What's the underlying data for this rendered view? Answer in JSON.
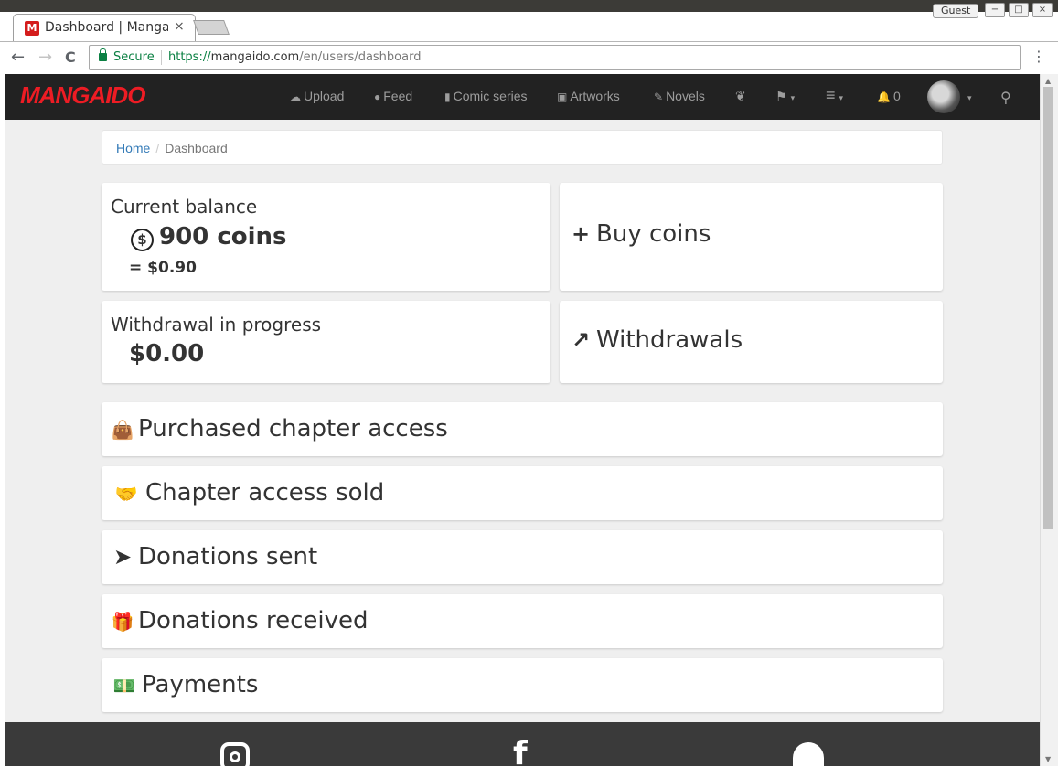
{
  "browser": {
    "tab_title": "Dashboard | Manga",
    "tab_favicon": "M",
    "tab_close": "×",
    "guest_label": "Guest",
    "window_buttons": [
      "−",
      "□",
      "×"
    ],
    "back": "←",
    "forward": "→",
    "reload": "C",
    "secure_label": "Secure",
    "url_scheme": "https://",
    "url_host": "mangaido.com",
    "url_path": "/en/users/dashboard",
    "menu": "⋮"
  },
  "navbar": {
    "logo": "MANGAIDO",
    "items": [
      {
        "icon": "upload-cloud-icon",
        "glyph": "☁",
        "label": "Upload"
      },
      {
        "icon": "chat-icon",
        "glyph": "●",
        "label": "Feed"
      },
      {
        "icon": "book-icon",
        "glyph": "▮",
        "label": "Comic series"
      },
      {
        "icon": "picture-icon",
        "glyph": "▣",
        "label": "Artworks"
      },
      {
        "icon": "edit-icon",
        "glyph": "✎",
        "label": "Novels"
      }
    ],
    "bowl_glyph": "❦",
    "flag_glyph": "⚑",
    "menu_glyph": "≡",
    "caret": "▾",
    "bell_glyph": "🔔",
    "notification_count": "0",
    "search_glyph": "⚲"
  },
  "breadcrumb": {
    "home": "Home",
    "separator": "/",
    "current": "Dashboard"
  },
  "balance": {
    "label": "Current balance",
    "coin_symbol": "$",
    "coins": "900 coins",
    "usd": "= $0.90"
  },
  "buy": {
    "glyph": "+",
    "label": "Buy coins"
  },
  "withdrawal": {
    "label": "Withdrawal in progress",
    "amount": "$0.00"
  },
  "withdrawals": {
    "glyph": "↗",
    "label": "Withdrawals"
  },
  "sections": [
    {
      "icon": "shopping-bag-icon",
      "glyph": "👜",
      "label": "Purchased chapter access"
    },
    {
      "icon": "handshake-icon",
      "glyph": "🤝",
      "label": "Chapter access sold"
    },
    {
      "icon": "paper-plane-icon",
      "glyph": "➤",
      "label": "Donations sent"
    },
    {
      "icon": "gift-icon",
      "glyph": "🎁",
      "label": "Donations received"
    },
    {
      "icon": "money-icon",
      "glyph": "💵",
      "label": "Payments"
    }
  ],
  "footer": {
    "facebook_glyph": "f"
  }
}
